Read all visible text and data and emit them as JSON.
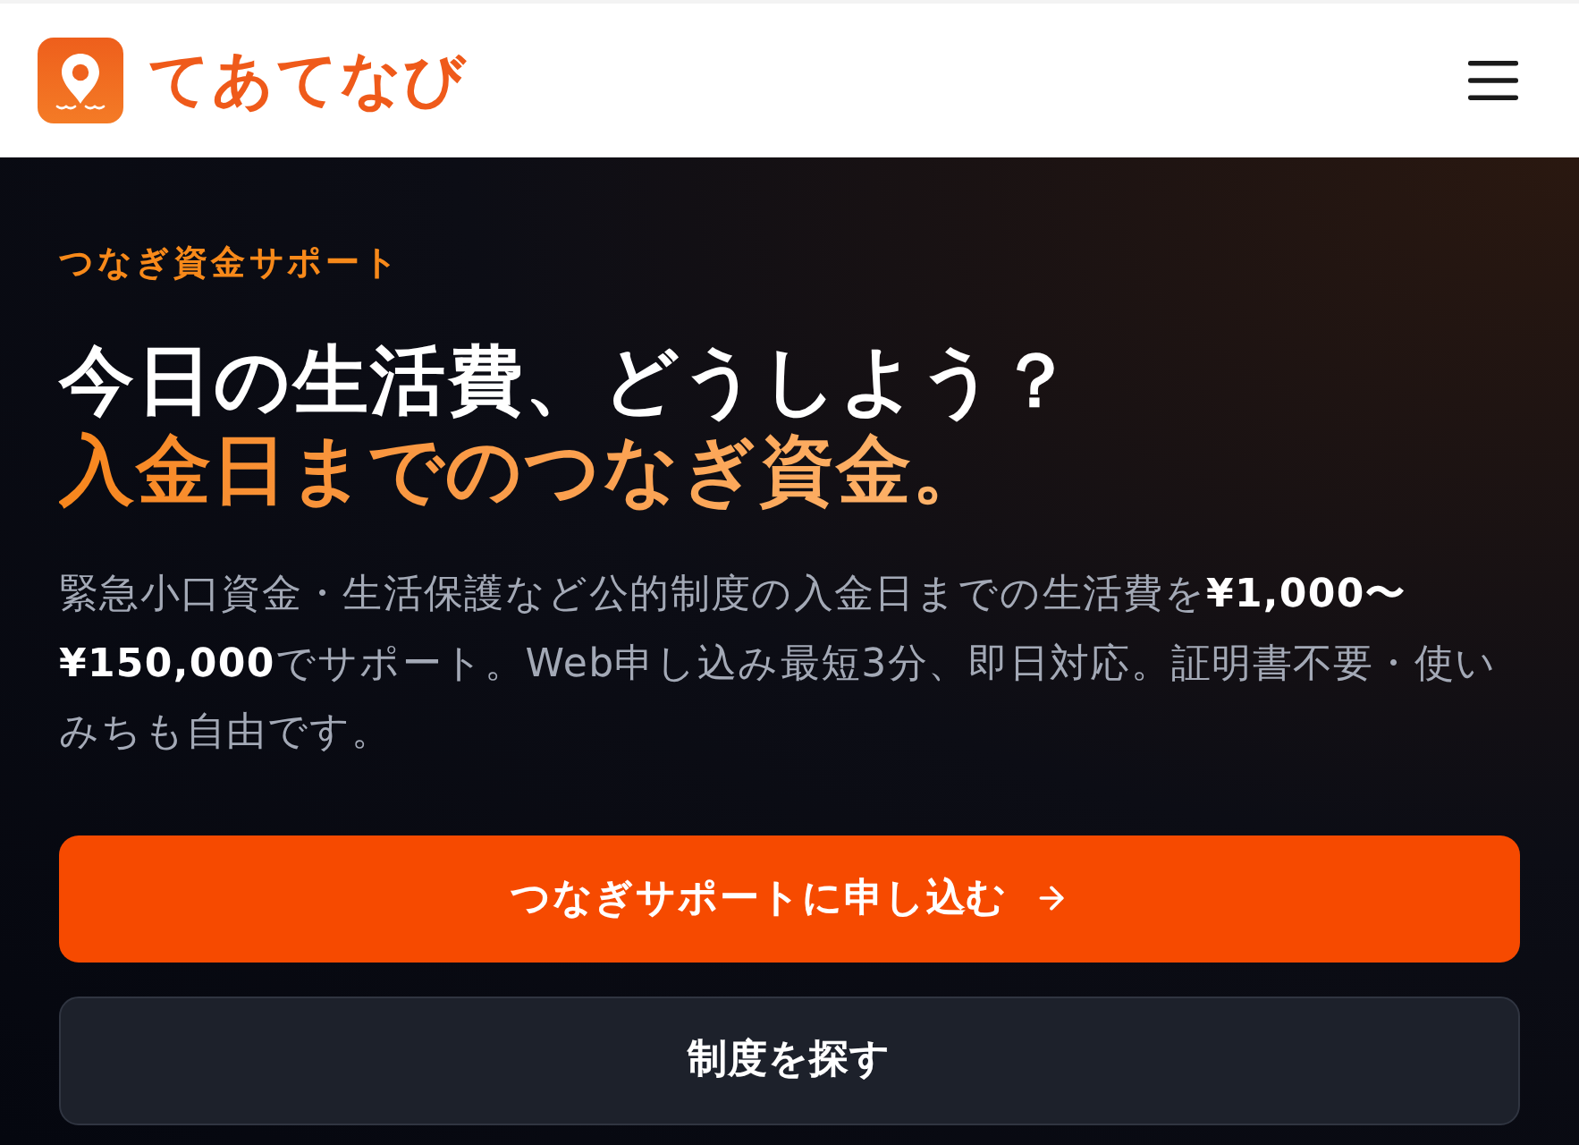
{
  "header": {
    "logo_text": "てあてなび"
  },
  "hero": {
    "eyebrow": "つなぎ資金サポート",
    "title": "今日の生活費、どうしよう？",
    "title_accent": "入金日までのつなぎ資金。",
    "description": "緊急小口資金・生活保護など公的制度の入金日までの生活費を**¥1,000〜¥150,000**でサポート。Web申し込み最短3分、即日対応。証明書不要・使いみちも自由です。"
  },
  "buttons": [
    {
      "kind": "primary",
      "label": "つなぎサポートに申し込む"
    },
    {
      "kind": "secondary",
      "label": "制度を探す"
    }
  ]
}
